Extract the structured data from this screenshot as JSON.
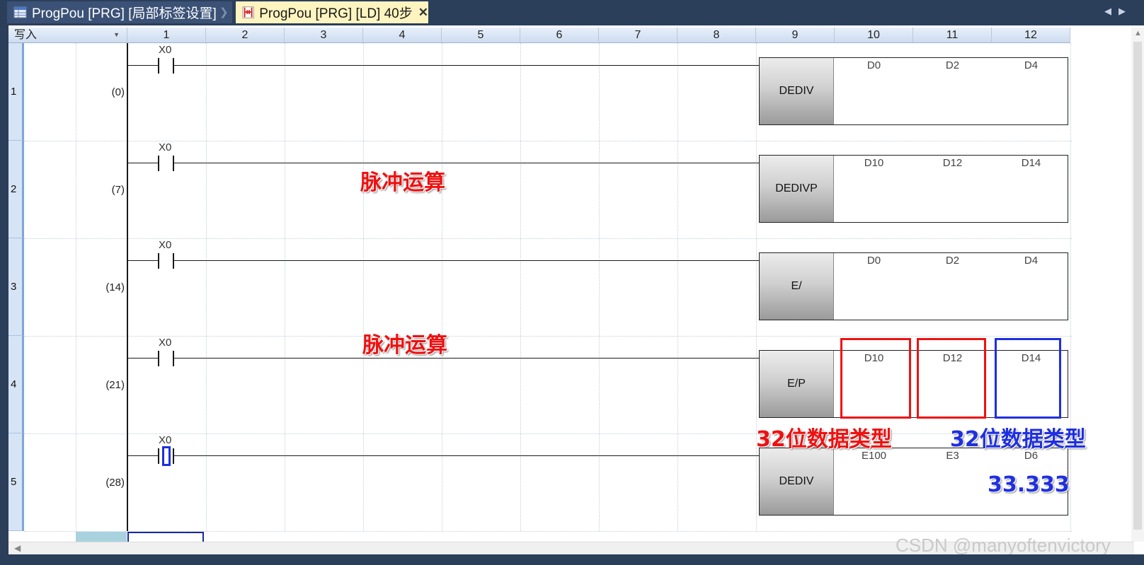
{
  "tabs": [
    {
      "label": "ProgPou [PRG] [局部标签设置]",
      "active": false,
      "icon": "label-table-icon"
    },
    {
      "label": "ProgPou [PRG] [LD] 40步",
      "active": true,
      "icon": "ladder-diagram-icon"
    }
  ],
  "header": {
    "mode": "写入",
    "columns": [
      "1",
      "2",
      "3",
      "4",
      "5",
      "6",
      "7",
      "8",
      "9",
      "10",
      "11",
      "12"
    ]
  },
  "rungs": [
    {
      "row": "1",
      "step": "(0)",
      "contact": "X0",
      "instruction": "DEDIV",
      "operands": [
        "D0",
        "D2",
        "D4"
      ]
    },
    {
      "row": "2",
      "step": "(7)",
      "contact": "X0",
      "instruction": "DEDIVP",
      "operands": [
        "D10",
        "D12",
        "D14"
      ]
    },
    {
      "row": "3",
      "step": "(14)",
      "contact": "X0",
      "instruction": "E/",
      "operands": [
        "D0",
        "D2",
        "D4"
      ]
    },
    {
      "row": "4",
      "step": "(21)",
      "contact": "X0",
      "instruction": "E/P",
      "operands": [
        "D10",
        "D12",
        "D14"
      ]
    },
    {
      "row": "5",
      "step": "(28)",
      "contact": "X0",
      "instruction": "DEDIV",
      "operands": [
        "E100",
        "E3",
        "D6"
      ]
    }
  ],
  "annotations": {
    "pulse_op_1": "脉冲运算",
    "pulse_op_2": "脉冲运算",
    "type_red": "32位数据类型",
    "type_blue": "32位数据类型",
    "result_value": "33.333"
  },
  "watermark": "CSDN @manyoftenvictory",
  "colors": {
    "tabbar": "#2b3e5a",
    "active_tab": "#fdf4bf",
    "annot_red": "#ee1111",
    "annot_blue": "#1f2fe0"
  }
}
